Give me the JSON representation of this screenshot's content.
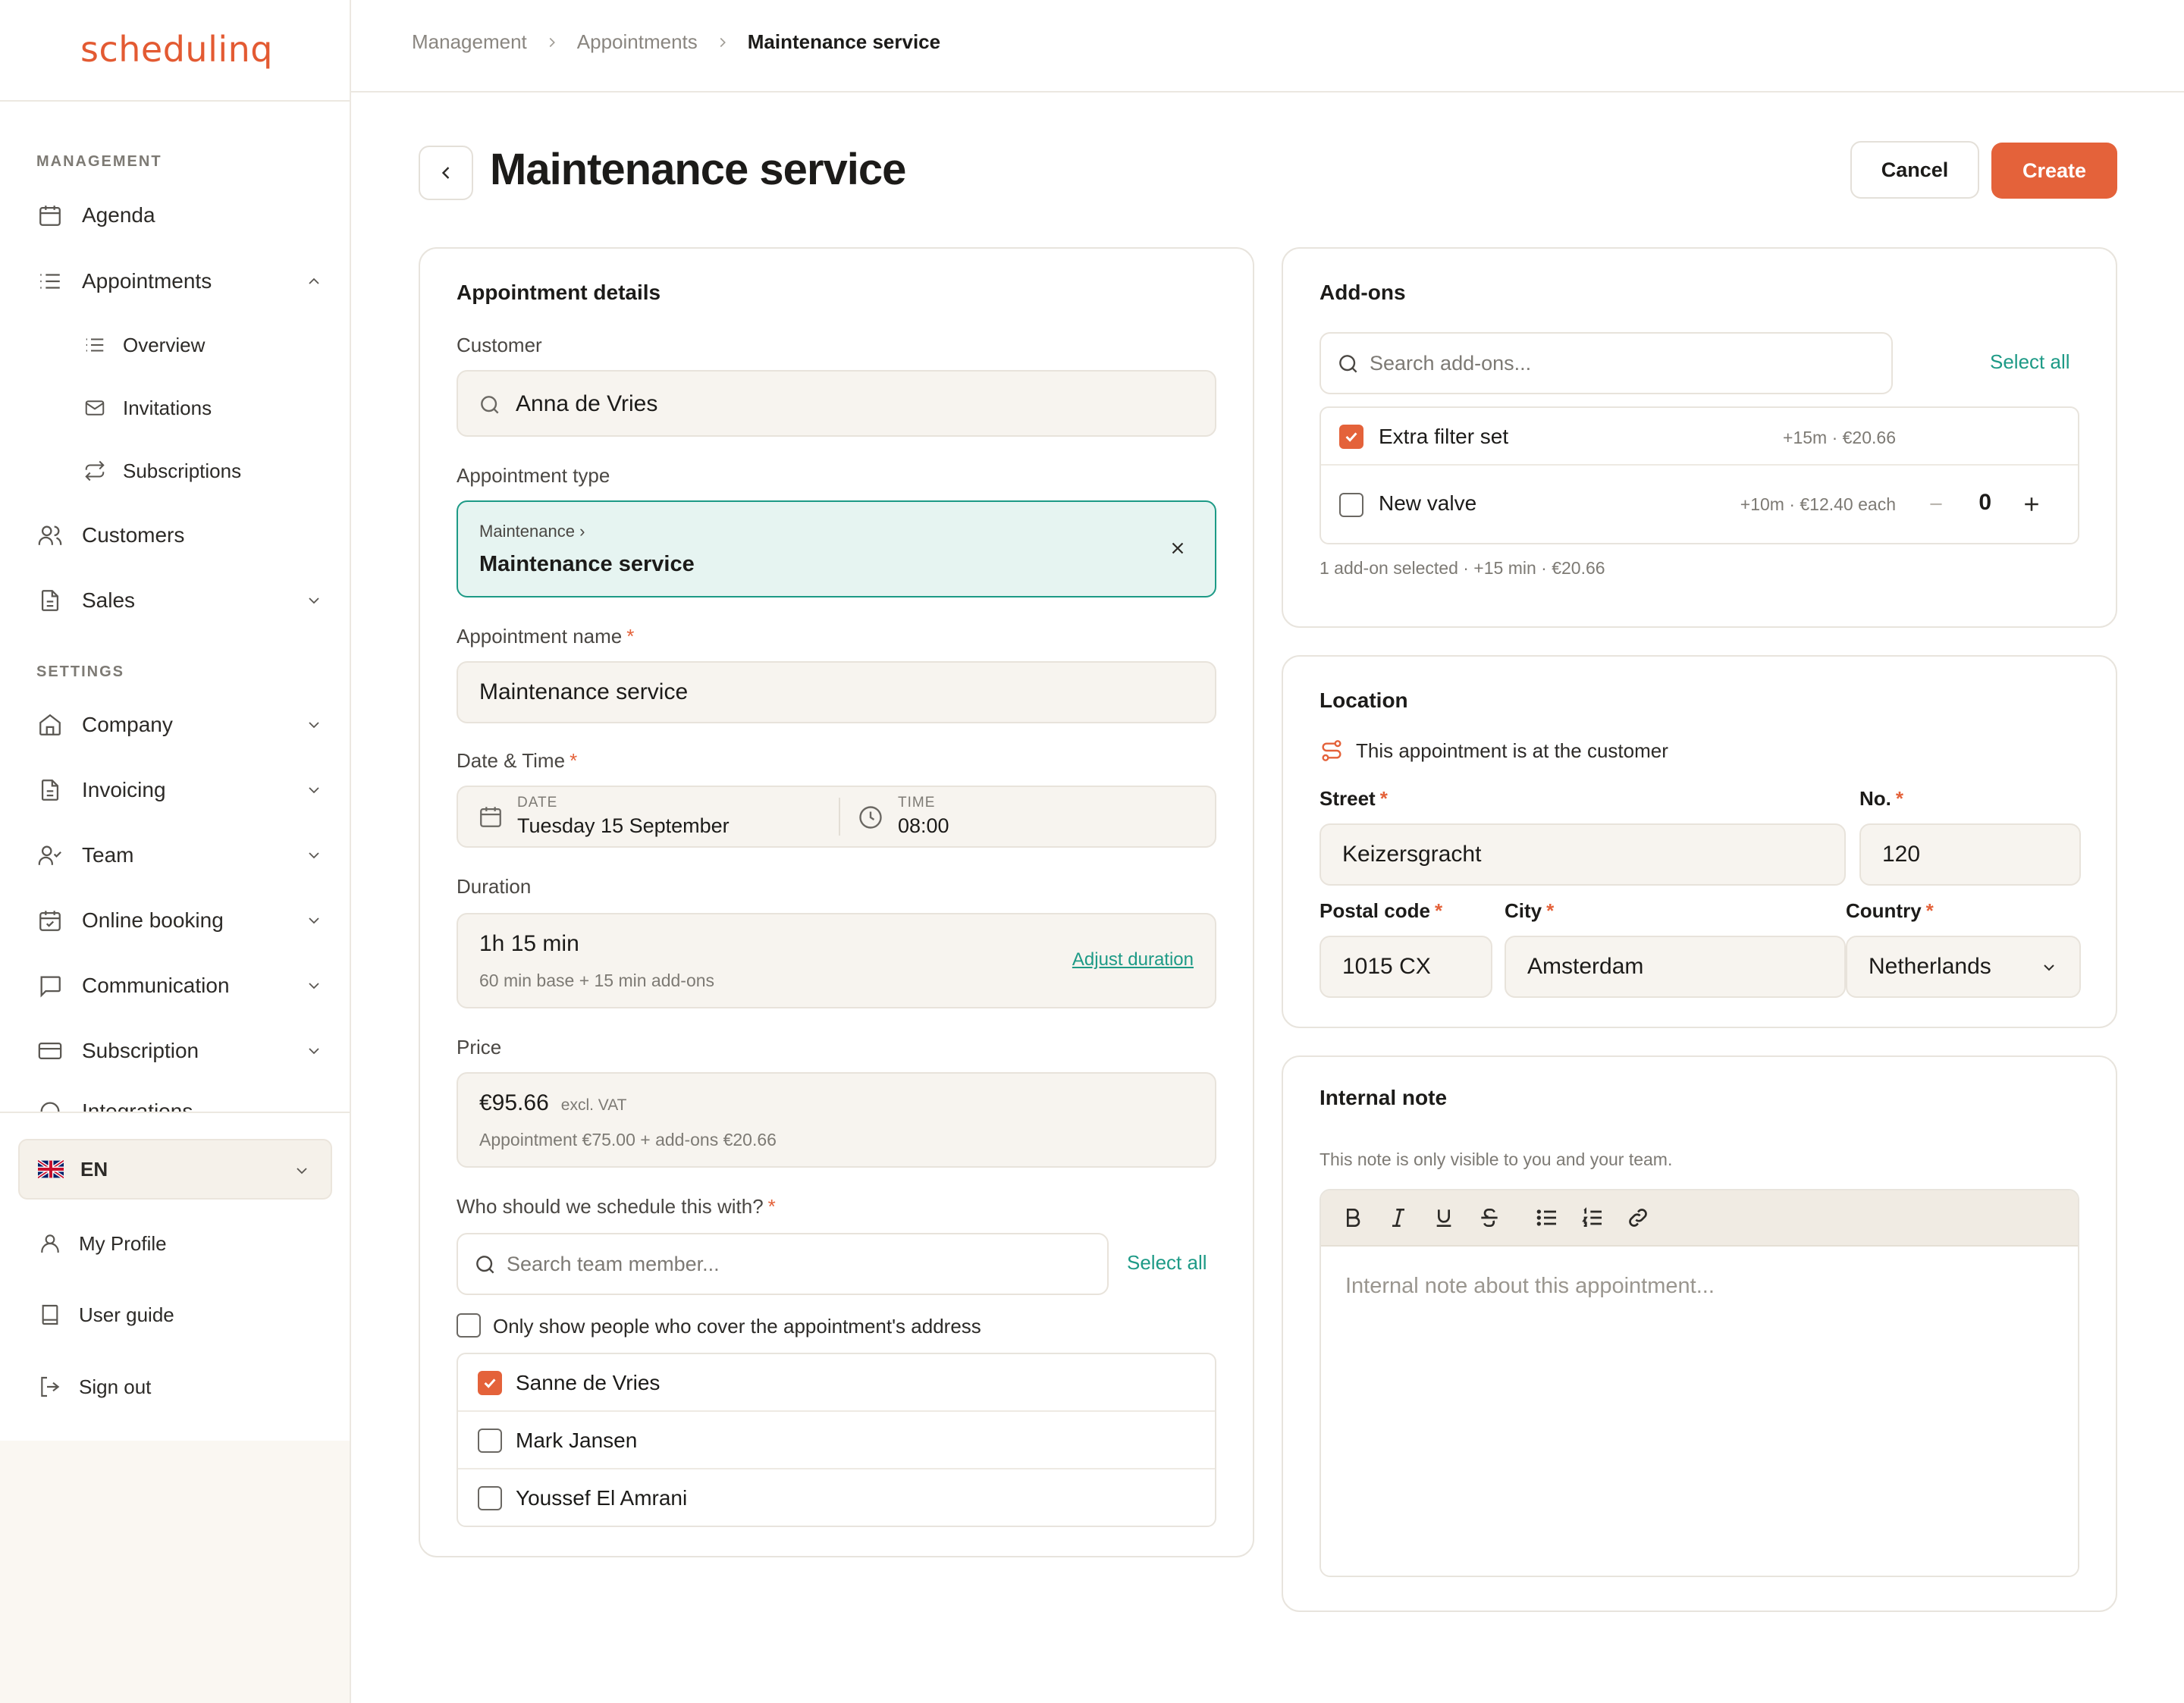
{
  "app": {
    "logo": "schedulinq"
  },
  "sidebar": {
    "management_label": "MANAGEMENT",
    "settings_label": "SETTINGS",
    "agenda": "Agenda",
    "appointments": "Appointments",
    "overview": "Overview",
    "invitations": "Invitations",
    "subscriptions": "Subscriptions",
    "customers": "Customers",
    "sales": "Sales",
    "company": "Company",
    "invoicing": "Invoicing",
    "team": "Team",
    "online_booking": "Online booking",
    "communication": "Communication",
    "subscription": "Subscription",
    "integrations": "Integrations",
    "language": "EN",
    "my_profile": "My Profile",
    "user_guide": "User guide",
    "sign_out": "Sign out"
  },
  "breadcrumb": [
    "Management",
    "Appointments",
    "Maintenance service"
  ],
  "header": {
    "title": "Maintenance service",
    "cancel": "Cancel",
    "create": "Create"
  },
  "details": {
    "title": "Appointment details",
    "customer_label": "Customer",
    "customer_value": "Anna de Vries",
    "type_label": "Appointment type",
    "type_parent": "Maintenance ›",
    "type_value": "Maintenance service",
    "name_label": "Appointment name",
    "name_value": "Maintenance service",
    "datetime_label": "Date & Time",
    "date_caption": "DATE",
    "date_value": "Tuesday 15 September",
    "time_caption": "TIME",
    "time_value": "08:00",
    "duration_label": "Duration",
    "duration_value": "1h 15 min",
    "duration_sub": "60 min base + 15 min add-ons",
    "adjust_duration": "Adjust duration",
    "price_label": "Price",
    "price_value": "€95.66",
    "price_vat": "excl. VAT",
    "price_sub": "Appointment €75.00 + add-ons €20.66",
    "schedule_label": "Who should we schedule this with?",
    "team_search_placeholder": "Search team member...",
    "select_all": "Select all",
    "only_cover": "Only show people who cover the appointment's address",
    "team": [
      {
        "name": "Sanne de Vries",
        "checked": true
      },
      {
        "name": "Mark Jansen",
        "checked": false
      },
      {
        "name": "Youssef El Amrani",
        "checked": false
      }
    ]
  },
  "addons": {
    "title": "Add-ons",
    "search_placeholder": "Search add-ons...",
    "select_all": "Select all",
    "items": [
      {
        "name": "Extra filter set",
        "meta": "+15m · €20.66",
        "checked": true
      },
      {
        "name": "New valve",
        "meta": "+10m · €12.40 each",
        "checked": false,
        "qty": "0"
      }
    ],
    "summary": "1 add-on selected · +15 min · €20.66"
  },
  "location": {
    "title": "Location",
    "at_customer": "This appointment is at the customer",
    "street_label": "Street",
    "street_value": "Keizersgracht",
    "no_label": "No.",
    "no_value": "120",
    "postal_label": "Postal code",
    "postal_value": "1015 CX",
    "city_label": "City",
    "city_value": "Amsterdam",
    "country_label": "Country",
    "country_value": "Netherlands"
  },
  "note": {
    "title": "Internal note",
    "hint": "This note is only visible to you and your team.",
    "placeholder": "Internal note about this appointment..."
  },
  "colors": {
    "accent": "#e4623a",
    "teal": "#1d9a86",
    "type_bg": "#e6f4f1"
  }
}
